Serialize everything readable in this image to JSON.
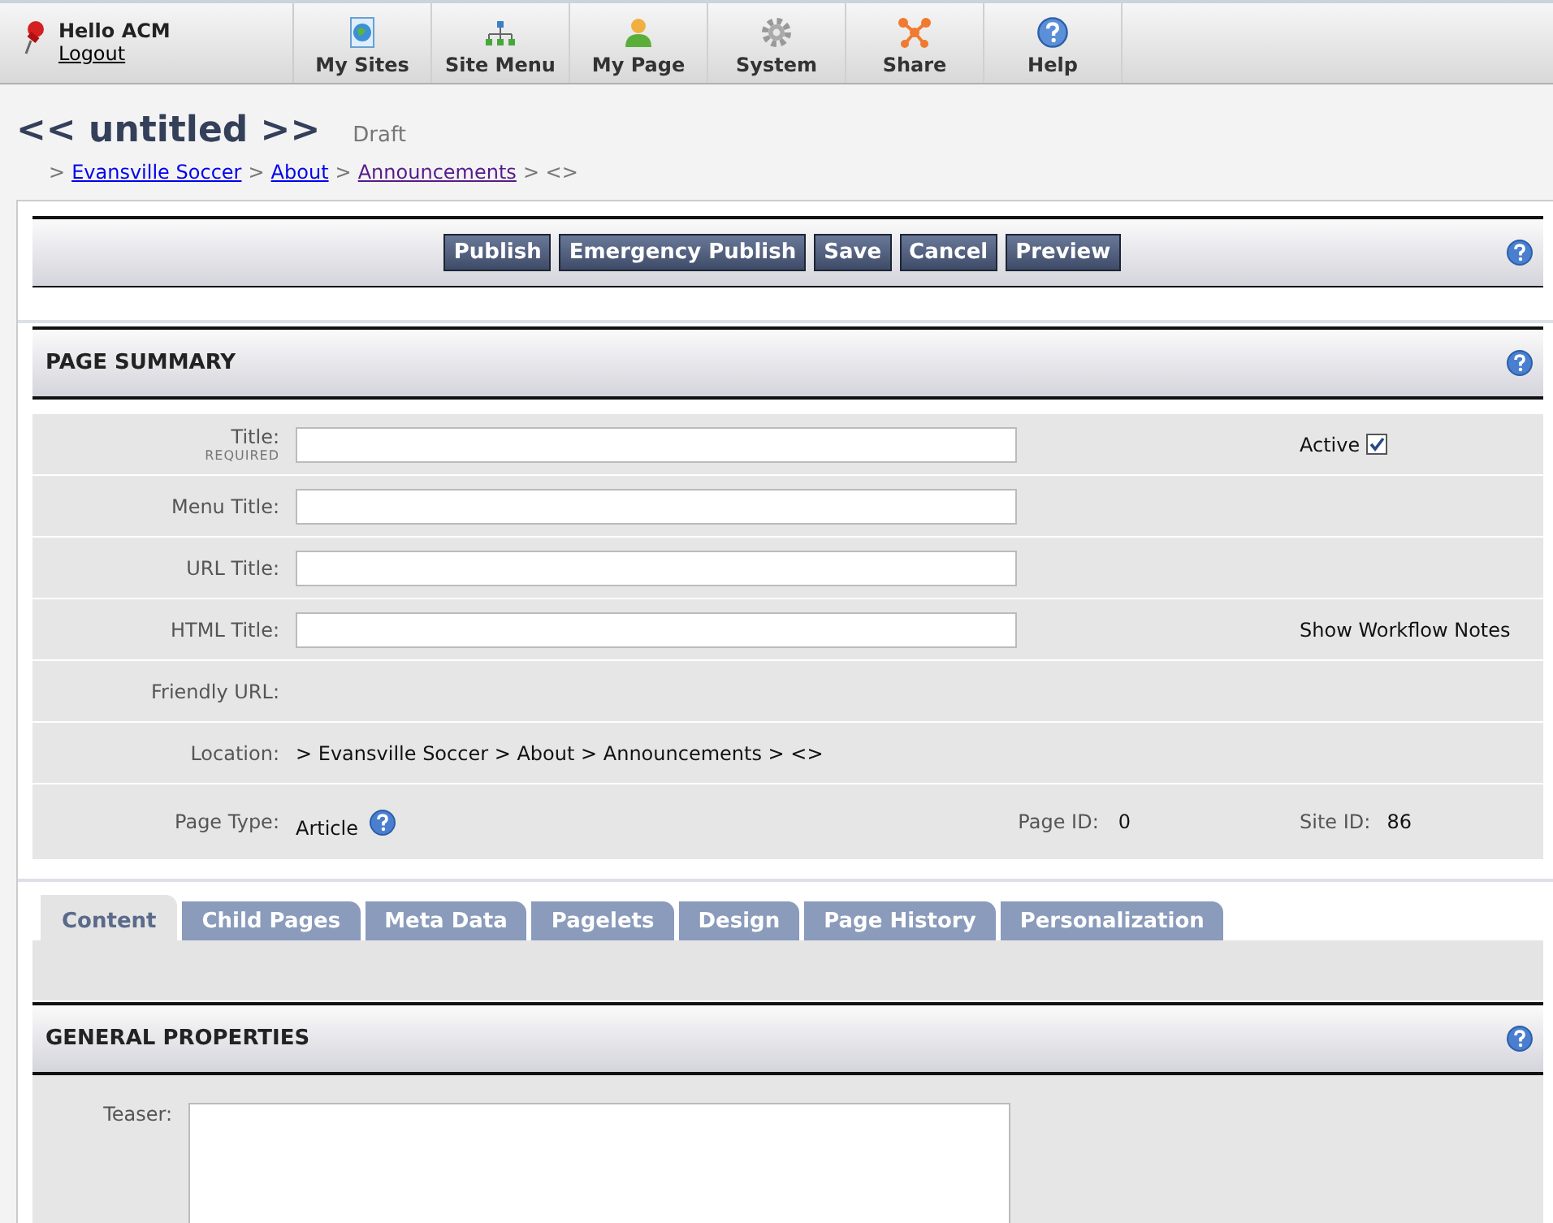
{
  "user": {
    "greeting": "Hello ACM",
    "logout": "Logout"
  },
  "nav": [
    {
      "label": "My Sites",
      "kind": "globe"
    },
    {
      "label": "Site Menu",
      "kind": "sitemap"
    },
    {
      "label": "My Page",
      "kind": "person"
    },
    {
      "label": "System",
      "kind": "gear"
    },
    {
      "label": "Share",
      "kind": "share"
    },
    {
      "label": "Help",
      "kind": "help"
    }
  ],
  "page": {
    "title": "<< untitled >>",
    "status": "Draft"
  },
  "breadcrumb": [
    {
      "label": ">",
      "kind": "text"
    },
    {
      "label": "Evansville Soccer",
      "kind": "link",
      "visited": false
    },
    {
      "label": ">",
      "kind": "text"
    },
    {
      "label": "About",
      "kind": "link",
      "visited": false
    },
    {
      "label": ">",
      "kind": "text"
    },
    {
      "label": "Announcements",
      "kind": "link",
      "visited": true
    },
    {
      "label": "> <>",
      "kind": "text"
    }
  ],
  "actions": [
    "Publish",
    "Emergency Publish",
    "Save",
    "Cancel",
    "Preview"
  ],
  "page_summary": {
    "title": "PAGE SUMMARY",
    "rows": [
      {
        "kind": "input",
        "label": "Title:",
        "note": "REQUIRED",
        "extra": {
          "kind": "checkbox",
          "label": "Active",
          "checked": true
        }
      },
      {
        "kind": "input",
        "label": "Menu Title:"
      },
      {
        "kind": "input",
        "label": "URL Title:"
      },
      {
        "kind": "input",
        "label": "HTML Title:",
        "extra": {
          "kind": "text",
          "label": "Show Workflow Notes"
        }
      },
      {
        "kind": "text",
        "label": "Friendly URL:"
      },
      {
        "kind": "text",
        "label": "Location:",
        "value": "> Evansville Soccer > About > Announcements > <>"
      },
      {
        "kind": "ids",
        "label": "Page Type:",
        "value": "Article",
        "page_id_label": "Page ID:",
        "page_id": "0",
        "site_id_label": "Site ID:",
        "site_id": "86"
      }
    ]
  },
  "tabs": [
    {
      "label": "Content",
      "selected": true
    },
    {
      "label": "Child Pages",
      "selected": false
    },
    {
      "label": "Meta Data",
      "selected": false
    },
    {
      "label": "Pagelets",
      "selected": false
    },
    {
      "label": "Design",
      "selected": false
    },
    {
      "label": "Page History",
      "selected": false
    },
    {
      "label": "Personalization",
      "selected": false
    }
  ],
  "general_properties": {
    "title": "GENERAL PROPERTIES",
    "fields": [
      {
        "label": "Teaser:"
      }
    ]
  }
}
